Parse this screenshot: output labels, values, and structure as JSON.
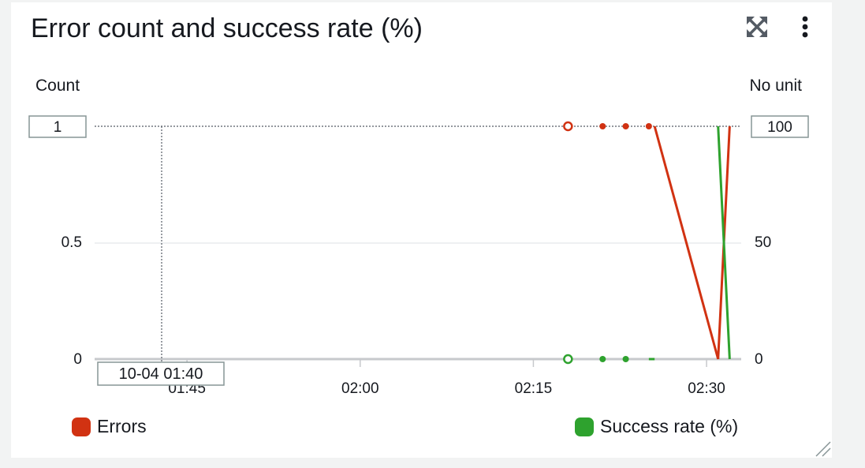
{
  "widget": {
    "title": "Error count and success rate (%)",
    "expand_icon": "expand-arrows-icon",
    "menu_icon": "vertical-ellipsis-icon"
  },
  "chart_data": {
    "type": "line",
    "title": "Error count and success rate (%)",
    "y_left": {
      "label": "Count",
      "ylim": [
        0,
        1
      ],
      "ticks": [
        "0",
        "0.5",
        "1"
      ]
    },
    "y_right": {
      "label": "No unit",
      "ylim": [
        0,
        100
      ],
      "ticks": [
        "0",
        "50",
        "100"
      ]
    },
    "x": {
      "ticks": [
        "01:45",
        "02:00",
        "02:15",
        "02:30"
      ],
      "range": [
        "01:37",
        "02:33"
      ]
    },
    "grid": true,
    "hover": {
      "time_label": "10-04 01:40",
      "left_value": "1",
      "right_value": "100"
    },
    "series": [
      {
        "name": "Errors",
        "axis": "left",
        "color": "#d13212",
        "points": [
          {
            "t": "02:18",
            "v": 1,
            "hollow": true
          },
          {
            "t": "02:21",
            "v": 1
          },
          {
            "t": "02:23",
            "v": 1
          },
          {
            "t": "02:25",
            "v": 1
          },
          {
            "t": "02:25.5",
            "v": 1
          },
          {
            "t": "02:31",
            "v": 0
          },
          {
            "t": "02:32",
            "v": 1
          }
        ],
        "segments": [
          [
            4,
            5
          ],
          [
            5,
            6
          ]
        ]
      },
      {
        "name": "Success rate (%)",
        "axis": "right",
        "color": "#2ea22e",
        "points": [
          {
            "t": "02:18",
            "v": 0,
            "hollow": true
          },
          {
            "t": "02:21",
            "v": 0
          },
          {
            "t": "02:23",
            "v": 0
          },
          {
            "t": "02:25",
            "v": 0
          },
          {
            "t": "02:25.5",
            "v": 0
          },
          {
            "t": "02:31",
            "v": 100
          },
          {
            "t": "02:32",
            "v": 0
          }
        ],
        "segments": [
          [
            3,
            4
          ],
          [
            5,
            6
          ]
        ]
      }
    ]
  },
  "legend": [
    {
      "label": "Errors",
      "color": "#d13212"
    },
    {
      "label": "Success rate (%)",
      "color": "#2ea22e"
    }
  ]
}
